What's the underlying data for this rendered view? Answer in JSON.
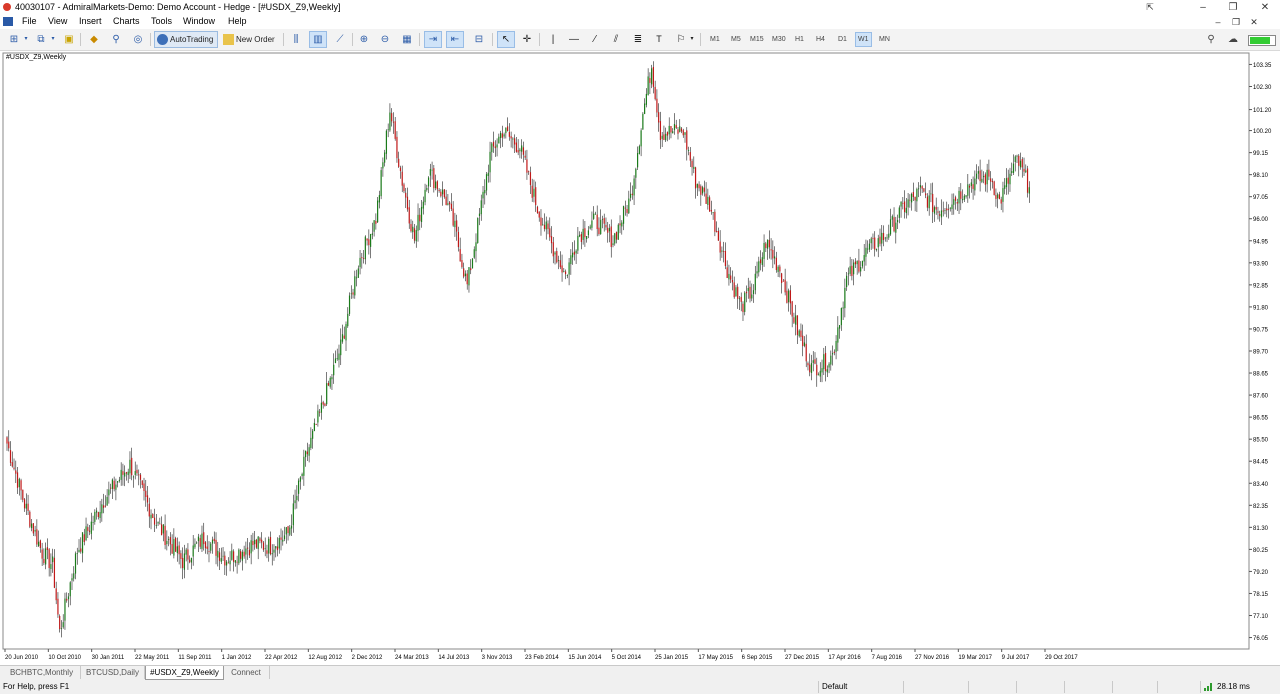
{
  "window": {
    "title": "40030107 - AdmiralMarkets-Demo: Demo Account - Hedge - [#USDX_Z9,Weekly]"
  },
  "menu": [
    "File",
    "View",
    "Insert",
    "Charts",
    "Tools",
    "Window",
    "Help"
  ],
  "toolbar": {
    "autotrading_label": "AutoTrading",
    "new_order_label": "New Order",
    "timeframes": [
      "M1",
      "M5",
      "M15",
      "M30",
      "H1",
      "H4",
      "D1",
      "W1",
      "MN"
    ],
    "active_timeframe": "W1"
  },
  "tabs": [
    {
      "label": "BCHBTC,Monthly",
      "active": false
    },
    {
      "label": "BTCUSD,Daily",
      "active": false
    },
    {
      "label": "#USDX_Z9,Weekly",
      "active": true
    },
    {
      "label": "Connect",
      "active": false
    }
  ],
  "status": {
    "help": "For Help, press F1",
    "profile": "Default",
    "ping": "28.18 ms"
  },
  "chart_data": {
    "type": "candlestick",
    "symbol_label": "#USDX_Z9,Weekly",
    "colors": {
      "bull": "#1a7a1a",
      "bear": "#c01818",
      "wick": "#222222"
    },
    "price_ticks": [
      "103.35",
      "102.30",
      "101.20",
      "100.20",
      "99.15",
      "98.10",
      "97.05",
      "96.00",
      "94.95",
      "93.90",
      "92.85",
      "91.80",
      "90.75",
      "89.70",
      "88.65",
      "87.60",
      "86.55",
      "85.50",
      "84.45",
      "83.40",
      "82.35",
      "81.30",
      "80.25",
      "79.20",
      "78.15",
      "77.10",
      "76.05"
    ],
    "date_ticks": [
      "20 Jun 2010",
      "10 Oct 2010",
      "30 Jan 2011",
      "22 May 2011",
      "11 Sep 2011",
      "1 Jan 2012",
      "22 Apr 2012",
      "12 Aug 2012",
      "2 Dec 2012",
      "24 Mar 2013",
      "14 Jul 2013",
      "3 Nov 2013",
      "23 Feb 2014",
      "15 Jun 2014",
      "5 Oct 2014",
      "25 Jan 2015",
      "17 May 2015",
      "6 Sep 2015",
      "27 Dec 2015",
      "17 Apr 2016",
      "7 Aug 2016",
      "27 Nov 2016",
      "19 Mar 2017",
      "9 Jul 2017",
      "29 Oct 2017"
    ],
    "ylim": [
      75.6,
      103.8
    ],
    "close_anchors": [
      [
        0,
        85.3
      ],
      [
        10,
        82.4
      ],
      [
        20,
        80.1
      ],
      [
        26,
        79.5
      ],
      [
        30,
        76.3
      ],
      [
        40,
        80.2
      ],
      [
        55,
        82.6
      ],
      [
        70,
        84.3
      ],
      [
        85,
        81.5
      ],
      [
        100,
        79.7
      ],
      [
        112,
        80.8
      ],
      [
        125,
        79.8
      ],
      [
        140,
        80.5
      ],
      [
        150,
        80.4
      ],
      [
        160,
        81.0
      ],
      [
        170,
        84.6
      ],
      [
        180,
        87.2
      ],
      [
        190,
        89.9
      ],
      [
        200,
        93.9
      ],
      [
        210,
        96.0
      ],
      [
        218,
        101.2
      ],
      [
        225,
        97.8
      ],
      [
        232,
        95.0
      ],
      [
        240,
        98.3
      ],
      [
        250,
        96.9
      ],
      [
        255,
        95.5
      ],
      [
        262,
        92.8
      ],
      [
        275,
        99.0
      ],
      [
        282,
        100.2
      ],
      [
        292,
        99.4
      ],
      [
        302,
        96.5
      ],
      [
        310,
        94.8
      ],
      [
        318,
        93.3
      ],
      [
        325,
        95.2
      ],
      [
        335,
        95.9
      ],
      [
        345,
        95.0
      ],
      [
        355,
        97.0
      ],
      [
        362,
        101.0
      ],
      [
        367,
        103.3
      ],
      [
        372,
        100.1
      ],
      [
        385,
        100.2
      ],
      [
        392,
        97.8
      ],
      [
        400,
        96.7
      ],
      [
        410,
        93.6
      ],
      [
        418,
        91.8
      ],
      [
        425,
        92.7
      ],
      [
        432,
        94.9
      ],
      [
        440,
        93.6
      ],
      [
        450,
        90.7
      ],
      [
        458,
        88.9
      ],
      [
        465,
        89.1
      ],
      [
        470,
        89.5
      ],
      [
        478,
        93.1
      ],
      [
        490,
        94.5
      ],
      [
        500,
        95.2
      ],
      [
        510,
        96.5
      ],
      [
        520,
        97.3
      ],
      [
        530,
        96.4
      ],
      [
        540,
        97.0
      ],
      [
        550,
        97.8
      ],
      [
        560,
        98.0
      ],
      [
        565,
        96.8
      ],
      [
        575,
        98.8
      ],
      [
        582,
        97.5
      ]
    ],
    "bar_count": 583,
    "visible_bars": 1250
  }
}
